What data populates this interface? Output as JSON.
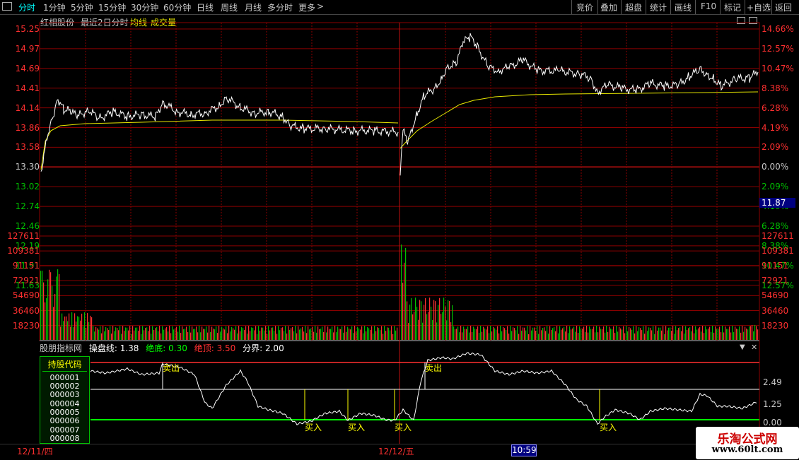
{
  "toolbar": {
    "left": [
      {
        "label": "分时",
        "active": true
      },
      {
        "label": "1分钟"
      },
      {
        "label": "5分钟"
      },
      {
        "label": "15分钟"
      },
      {
        "label": "30分钟"
      },
      {
        "label": "60分钟"
      },
      {
        "label": "日线"
      },
      {
        "label": "周线"
      },
      {
        "label": "月线"
      },
      {
        "label": "多分时"
      },
      {
        "label": "更多"
      }
    ],
    "right": [
      {
        "label": "竞价"
      },
      {
        "label": "叠加"
      },
      {
        "label": "超盘"
      },
      {
        "label": "统计"
      },
      {
        "label": "画线"
      },
      {
        "label": "F10"
      },
      {
        "label": "标记"
      },
      {
        "label": "+自选"
      },
      {
        "label": "返回"
      }
    ]
  },
  "info": {
    "stock_name": "红相股份",
    "period": "最近2日分时",
    "avg_line": "均线",
    "volume": "成交量"
  },
  "price_axis": {
    "left": [
      "15.25",
      "14.97",
      "14.69",
      "14.41",
      "14.14",
      "13.86",
      "13.58",
      "13.30",
      "13.02",
      "12.74",
      "12.46",
      "12.19",
      "11.91",
      "11.63"
    ],
    "right": [
      "14.66%",
      "12.57%",
      "10.47%",
      "8.38%",
      "6.28%",
      "4.19%",
      "2.09%",
      "0.00%",
      "2.09%",
      "4.19%",
      "6.28%",
      "8.38%",
      "10.47%",
      "12.57%"
    ],
    "current_price": "11.87"
  },
  "volume_axis": [
    "127611",
    "109381",
    "91151",
    "72921",
    "54690",
    "36460",
    "18230"
  ],
  "indicator": {
    "name": "股朋指标网",
    "cpx_label": "操盘线:",
    "cpx_value": "1.38",
    "bottom_label": "绝底:",
    "bottom_value": "0.30",
    "top_label": "绝顶:",
    "top_value": "3.50",
    "divide_label": "分界:",
    "divide_value": "2.00",
    "right_axis": [
      "2.49",
      "1.25",
      "0.00"
    ],
    "markers": {
      "sell": "卖出",
      "buy": "买入"
    }
  },
  "holdings": {
    "title": "持股代码",
    "codes": [
      "000001",
      "000002",
      "000003",
      "000004",
      "000005",
      "000006",
      "000007",
      "000008"
    ]
  },
  "bottom": {
    "date1": "12/11/四",
    "date2": "12/12/五",
    "time": "10:59"
  },
  "watermark": {
    "line1": "乐淘公式网",
    "line2": "www.60lt.com"
  },
  "colors": {
    "grid": "#8b0000",
    "price_line": "#ffffff",
    "avg_line": "#e8e800",
    "up": "#ff3030",
    "down": "#00c000",
    "bg": "#000000"
  }
}
